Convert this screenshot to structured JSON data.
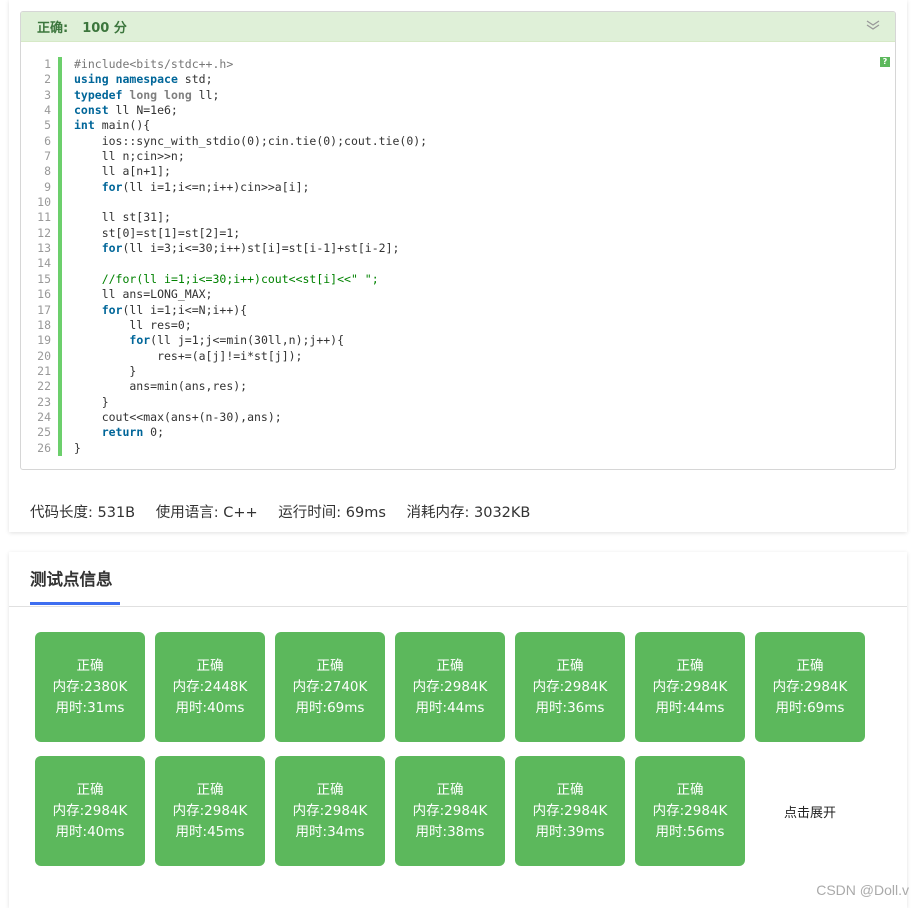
{
  "result": {
    "status": "正确:",
    "score": "100 分"
  },
  "code_lines": [
    "#include<bits/stdc++.h>",
    "using namespace std;",
    "typedef long long ll;",
    "const ll N=1e6;",
    "int main(){",
    "    ios::sync_with_stdio(0);cin.tie(0);cout.tie(0);",
    "    ll n;cin>>n;",
    "    ll a[n+1];",
    "    for(ll i=1;i<=n;i++)cin>>a[i];",
    "",
    "    ll st[31];",
    "    st[0]=st[1]=st[2]=1;",
    "    for(ll i=3;i<=30;i++)st[i]=st[i-1]+st[i-2];",
    "",
    "    //for(ll i=1;i<=30;i++)cout<<st[i]<<\" \";",
    "    ll ans=LONG_MAX;",
    "    for(ll i=1;i<=N;i++){",
    "        ll res=0;",
    "        for(ll j=1;j<=min(30ll,n);j++){",
    "            res+=(a[j]!=i*st[j]);",
    "        }",
    "        ans=min(ans,res);",
    "    }",
    "    cout<<max(ans+(n-30),ans);",
    "    return 0;",
    "}"
  ],
  "help_icon_label": "?",
  "stats": {
    "code_length": "代码长度: 531B",
    "language": "使用语言: C++",
    "run_time": "运行时间: 69ms",
    "memory": "消耗内存: 3032KB"
  },
  "testcases_title": "测试点信息",
  "testcases": [
    {
      "status": "正确",
      "memory": "内存:2380K",
      "time": "用时:31ms"
    },
    {
      "status": "正确",
      "memory": "内存:2448K",
      "time": "用时:40ms"
    },
    {
      "status": "正确",
      "memory": "内存:2740K",
      "time": "用时:69ms"
    },
    {
      "status": "正确",
      "memory": "内存:2984K",
      "time": "用时:44ms"
    },
    {
      "status": "正确",
      "memory": "内存:2984K",
      "time": "用时:36ms"
    },
    {
      "status": "正确",
      "memory": "内存:2984K",
      "time": "用时:44ms"
    },
    {
      "status": "正确",
      "memory": "内存:2984K",
      "time": "用时:69ms"
    },
    {
      "status": "正确",
      "memory": "内存:2984K",
      "time": "用时:40ms"
    },
    {
      "status": "正确",
      "memory": "内存:2984K",
      "time": "用时:45ms"
    },
    {
      "status": "正确",
      "memory": "内存:2984K",
      "time": "用时:34ms"
    },
    {
      "status": "正确",
      "memory": "内存:2984K",
      "time": "用时:38ms"
    },
    {
      "status": "正确",
      "memory": "内存:2984K",
      "time": "用时:39ms"
    },
    {
      "status": "正确",
      "memory": "内存:2984K",
      "time": "用时:56ms"
    }
  ],
  "expand_label": "点击展开",
  "watermark": "CSDN @Doll.v",
  "colors": {
    "accepted_tile": "#5cb85c",
    "header_bg": "#dff0d8",
    "header_text": "#3c763d",
    "tab_underline": "#3e6ef0"
  },
  "icons": [
    "chevron-double-down-icon",
    "help-icon"
  ]
}
